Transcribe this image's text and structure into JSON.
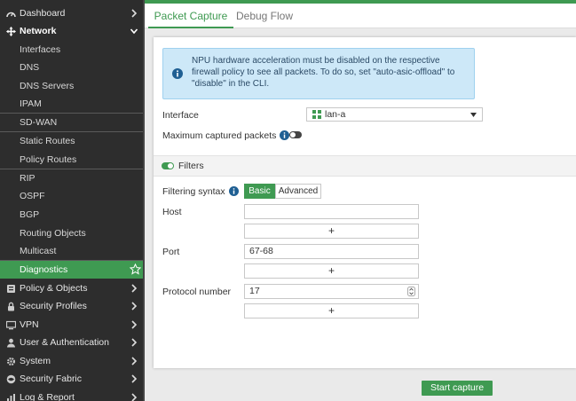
{
  "sidebar": {
    "items": [
      {
        "label": "Dashboard",
        "icon": "dashboard-icon"
      },
      {
        "label": "Network",
        "icon": "network-icon"
      },
      {
        "label": "Interfaces"
      },
      {
        "label": "DNS"
      },
      {
        "label": "DNS Servers"
      },
      {
        "label": "IPAM"
      },
      {
        "label": "SD-WAN"
      },
      {
        "label": "Static Routes"
      },
      {
        "label": "Policy Routes"
      },
      {
        "label": "RIP"
      },
      {
        "label": "OSPF"
      },
      {
        "label": "BGP"
      },
      {
        "label": "Routing Objects"
      },
      {
        "label": "Multicast"
      },
      {
        "label": "Diagnostics"
      },
      {
        "label": "Policy & Objects",
        "icon": "policy-icon"
      },
      {
        "label": "Security Profiles",
        "icon": "lock-icon"
      },
      {
        "label": "VPN",
        "icon": "monitor-icon"
      },
      {
        "label": "User & Authentication",
        "icon": "user-icon"
      },
      {
        "label": "System",
        "icon": "gear-icon"
      },
      {
        "label": "Security Fabric",
        "icon": "fabric-icon"
      },
      {
        "label": "Log & Report",
        "icon": "chart-icon"
      }
    ]
  },
  "tabs": {
    "packet_capture": "Packet Capture",
    "debug_flow": "Debug Flow"
  },
  "info": {
    "message": "NPU hardware acceleration must be disabled on the respective firewall policy to see all packets. To do so, set \"auto-asic-offload\" to \"disable\" in the CLI."
  },
  "form": {
    "interface_label": "Interface",
    "interface_value": "lan-a",
    "max_packets_label": "Maximum captured packets",
    "filters_label": "Filters",
    "filtering_syntax_label": "Filtering syntax",
    "syntax_basic": "Basic",
    "syntax_advanced": "Advanced",
    "host_label": "Host",
    "host_value": "",
    "add": "+",
    "port_label": "Port",
    "port_value": "67-68",
    "protocol_label": "Protocol number",
    "protocol_value": "17"
  },
  "actions": {
    "start_capture": "Start capture"
  },
  "colors": {
    "accent": "#3f9a52",
    "sidebar_bg": "#2d2d2d",
    "info_bg": "#cde8f8"
  }
}
